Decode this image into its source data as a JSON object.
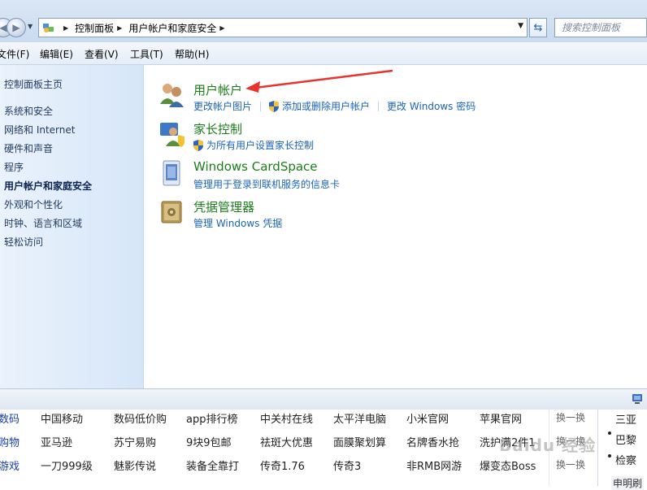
{
  "address": {
    "crumbs": [
      "控制面板",
      "用户帐户和家庭安全"
    ],
    "search_placeholder": "搜索控制面板"
  },
  "menu": [
    "文件(F)",
    "编辑(E)",
    "查看(V)",
    "工具(T)",
    "帮助(H)"
  ],
  "sidebar": {
    "home": "控制面板主页",
    "items": [
      "系统和安全",
      "网络和 Internet",
      "硬件和声音",
      "程序",
      "用户帐户和家庭安全",
      "外观和个性化",
      "时钟、语言和区域",
      "轻松访问"
    ],
    "active_index": 4
  },
  "categories": [
    {
      "title": "用户帐户",
      "links": [
        {
          "label": "更改帐户图片",
          "shield": false
        },
        {
          "label": "添加或删除用户帐户",
          "shield": true
        },
        {
          "label": "更改 Windows 密码",
          "shield": false
        }
      ]
    },
    {
      "title": "家长控制",
      "links": [
        {
          "label": "为所有用户设置家长控制",
          "shield": true
        }
      ]
    },
    {
      "title": "Windows CardSpace",
      "links": [
        {
          "label": "管理用于登录到联机服务的信息卡",
          "shield": false
        }
      ]
    },
    {
      "title": "凭据管理器",
      "links": [
        {
          "label": "管理 Windows 凭据",
          "shield": false
        }
      ]
    }
  ],
  "webpage": {
    "rows": [
      [
        "数码",
        "中国移动",
        "数码低价购",
        "app排行榜",
        "中关村在线",
        "太平洋电脑",
        "小米官网",
        "苹果官网",
        "换一换"
      ],
      [
        "购物",
        "亚马逊",
        "苏宁易购",
        "9块9包邮",
        "祛斑大优惠",
        "面膜聚划算",
        "名牌香水抢",
        "洗护满2件1",
        "换一换"
      ],
      [
        "游戏",
        "一刀999级",
        "魅影传说",
        "装备全靠打",
        "传奇1.76",
        "传奇3",
        "非RMB网游",
        "爆变态Boss",
        "换一换"
      ]
    ],
    "side": [
      "三亚",
      "巴黎",
      "检察"
    ],
    "bottom": "申明刷",
    "watermark": "Baidu 经验"
  },
  "colors": {
    "category_title": "#1a7d1a",
    "link": "#1a63b8",
    "annotation_arrow": "#e8342c"
  }
}
